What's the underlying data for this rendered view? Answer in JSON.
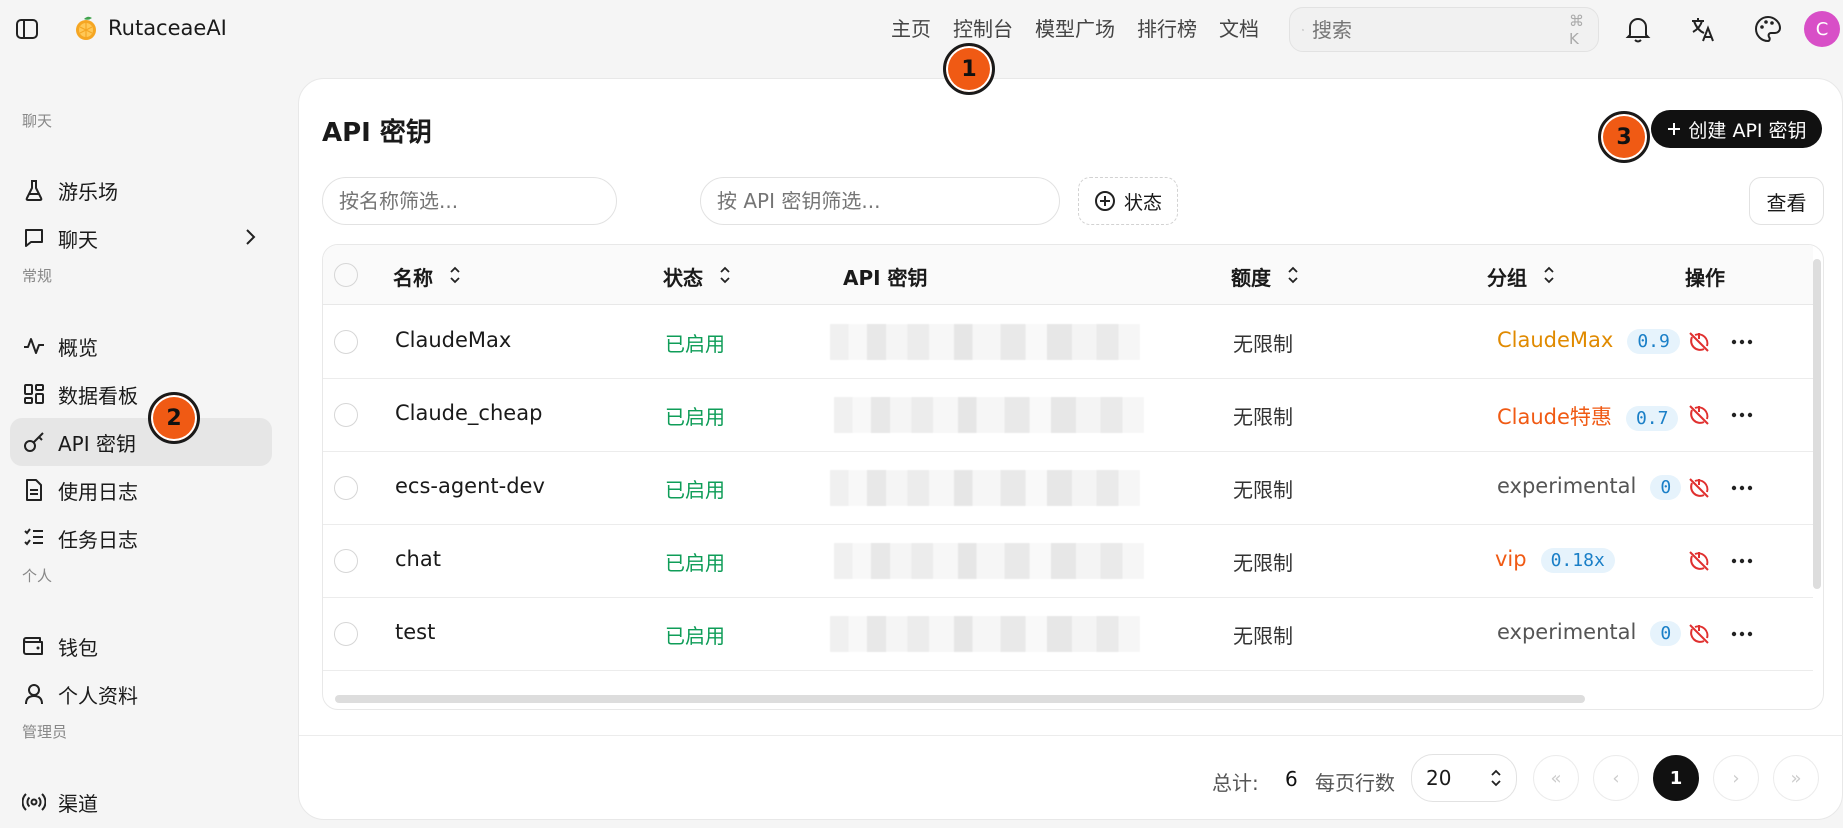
{
  "app": {
    "name": "RutaceaeAI"
  },
  "nav": {
    "items": [
      "主页",
      "控制台",
      "模型广场",
      "排行榜",
      "文档"
    ]
  },
  "search": {
    "placeholder": "搜索",
    "shortcut": "⌘ K"
  },
  "user": {
    "avatar_letter": "C"
  },
  "sidebar": {
    "sections": [
      {
        "title": "聊天",
        "items": [
          {
            "label": "游乐场",
            "icon": "flask-icon"
          },
          {
            "label": "聊天",
            "icon": "chat-icon",
            "has_chevron": true
          }
        ]
      },
      {
        "title": "常规",
        "items": [
          {
            "label": "概览",
            "icon": "activity-icon"
          },
          {
            "label": "数据看板",
            "icon": "dashboard-icon"
          },
          {
            "label": "API 密钥",
            "icon": "key-icon",
            "active": true
          },
          {
            "label": "使用日志",
            "icon": "file-icon"
          },
          {
            "label": "任务日志",
            "icon": "list-check-icon"
          }
        ]
      },
      {
        "title": "个人",
        "items": [
          {
            "label": "钱包",
            "icon": "wallet-icon"
          },
          {
            "label": "个人资料",
            "icon": "user-icon"
          }
        ]
      },
      {
        "title": "管理员",
        "items": [
          {
            "label": "渠道",
            "icon": "radio-icon"
          }
        ]
      }
    ]
  },
  "page": {
    "title": "API 密钥",
    "create_label": "创建 API 密钥",
    "filter_name_placeholder": "按名称筛选...",
    "filter_key_placeholder": "按 API 密钥筛选...",
    "status_filter_label": "状态",
    "view_label": "查看"
  },
  "table": {
    "headers": {
      "name": "名称",
      "status": "状态",
      "key": "API 密钥",
      "quota": "额度",
      "group": "分组",
      "actions": "操作"
    },
    "rows": [
      {
        "name": "ClaudeMax",
        "status": "已启用",
        "quota": "无限制",
        "group": "ClaudeMax",
        "group_color": "#e08a00",
        "ratio": "0.9"
      },
      {
        "name": "Claude_cheap",
        "status": "已启用",
        "quota": "无限制",
        "group": "Claude特惠",
        "group_color": "#f05a14",
        "ratio": "0.7"
      },
      {
        "name": "ecs-agent-dev",
        "status": "已启用",
        "quota": "无限制",
        "group": "experimental",
        "group_color": "#555555",
        "ratio": "0"
      },
      {
        "name": "chat",
        "status": "已启用",
        "quota": "无限制",
        "group": "vip",
        "group_color": "#f05a14",
        "ratio": "0.18x"
      },
      {
        "name": "test",
        "status": "已启用",
        "quota": "无限制",
        "group": "experimental",
        "group_color": "#555555",
        "ratio": "0"
      }
    ]
  },
  "pagination": {
    "total_label": "总计:",
    "total": "6",
    "per_page_label": "每页行数",
    "per_page": "20",
    "current_page": "1"
  },
  "markers": [
    "1",
    "2",
    "3"
  ],
  "colors": {
    "accent": "#f05a14",
    "enabled": "#0f9d58",
    "primary": "#111111",
    "avatar": "#d84fc7",
    "ratio_bg": "#e6f3fc"
  }
}
